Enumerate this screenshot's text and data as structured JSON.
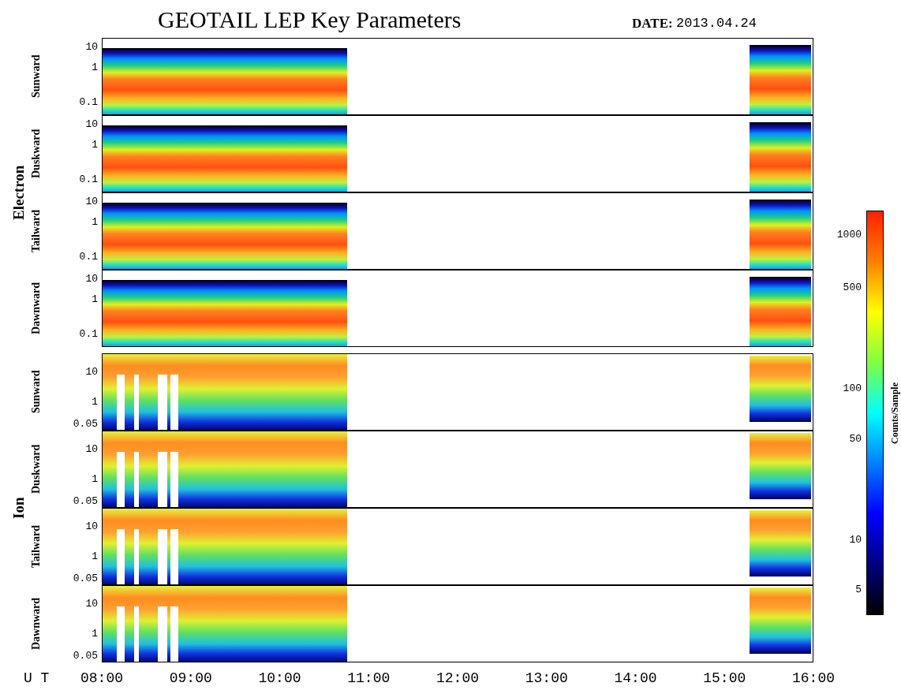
{
  "title": "GEOTAIL LEP Key Parameters",
  "date": {
    "label": "DATE:",
    "value": "2013.04.24"
  },
  "groups": [
    {
      "name": "Electron",
      "kind": "electron",
      "panels": [
        {
          "label": "Sunward",
          "yticks": [
            "10",
            "1",
            "0.1"
          ]
        },
        {
          "label": "Duskward",
          "yticks": [
            "10",
            "1",
            "0.1"
          ]
        },
        {
          "label": "Tailward",
          "yticks": [
            "10",
            "1",
            "0.1"
          ]
        },
        {
          "label": "Dawnward",
          "yticks": [
            "10",
            "1",
            "0.1"
          ]
        }
      ]
    },
    {
      "name": "Ion",
      "kind": "ion",
      "panels": [
        {
          "label": "Sunward",
          "yticks": [
            "10",
            "1",
            "0.05"
          ]
        },
        {
          "label": "Duskward",
          "yticks": [
            "10",
            "1",
            "0.05"
          ]
        },
        {
          "label": "Tailward",
          "yticks": [
            "10",
            "1",
            "0.05"
          ]
        },
        {
          "label": "Dawnward",
          "yticks": [
            "10",
            "1",
            "0.05"
          ]
        }
      ]
    }
  ],
  "x_axis": {
    "label": "U T",
    "ticks": [
      "08:00",
      "09:00",
      "10:00",
      "11:00",
      "12:00",
      "13:00",
      "14:00",
      "15:00",
      "16:00"
    ]
  },
  "colorbar": {
    "title": "Counts/Sample",
    "ticks": [
      "1000",
      "500",
      "100",
      "50",
      "10",
      "5"
    ]
  }
}
